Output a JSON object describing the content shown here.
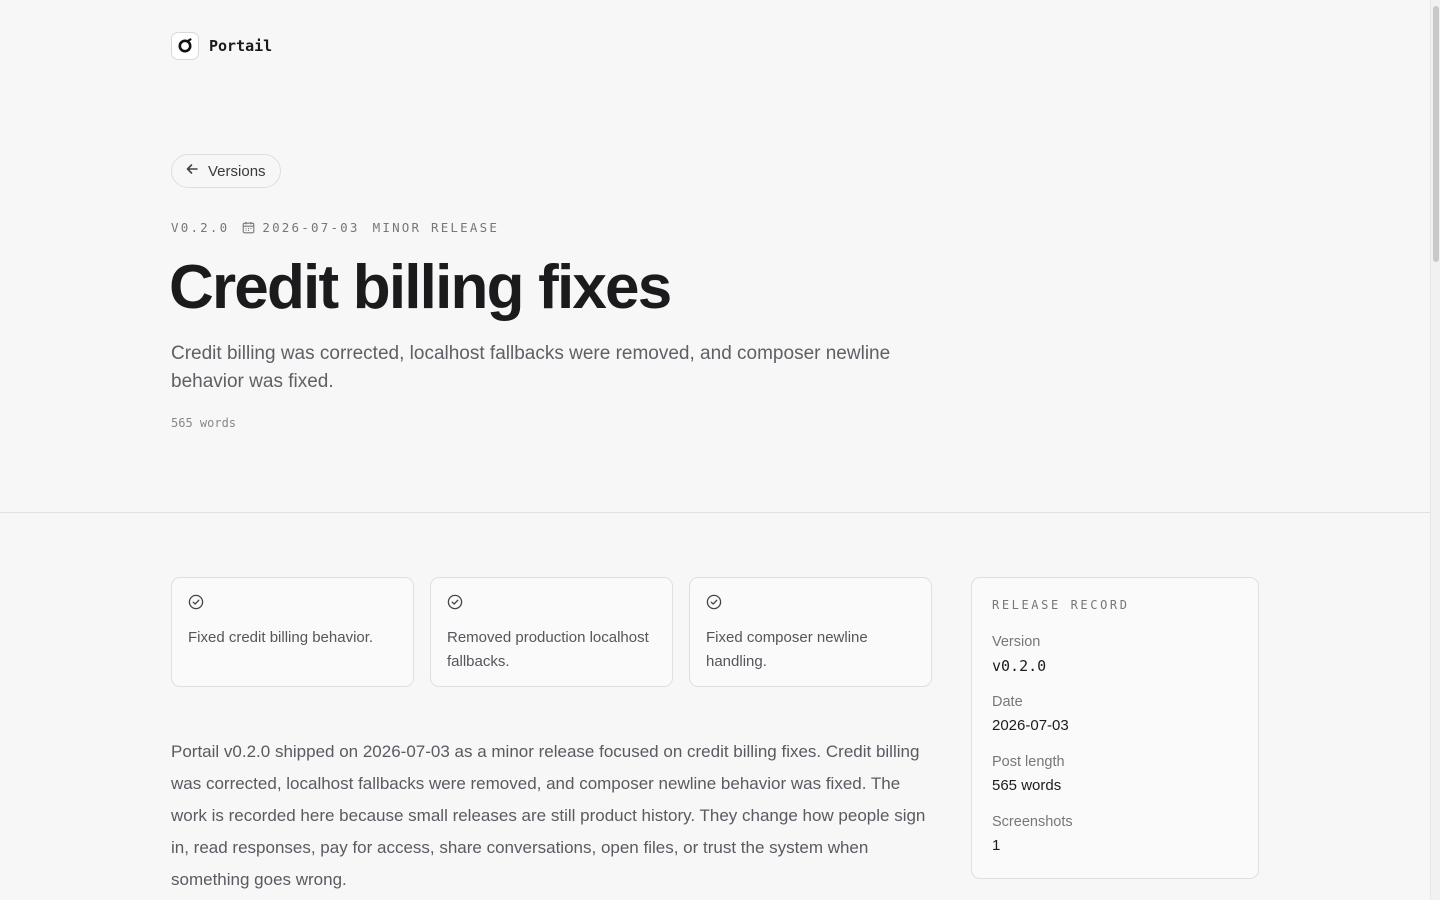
{
  "brand": {
    "name": "Portail"
  },
  "nav": {
    "back_label": "Versions"
  },
  "release": {
    "version": "V0.2.0",
    "date": "2026-07-03",
    "type": "MINOR RELEASE",
    "title": "Credit billing fixes",
    "summary": "Credit billing was corrected, localhost fallbacks were removed, and composer newline behavior was fixed.",
    "word_count": "565 words"
  },
  "highlights": [
    {
      "text": "Fixed credit billing behavior."
    },
    {
      "text": "Removed production localhost fallbacks."
    },
    {
      "text": "Fixed composer newline handling."
    }
  ],
  "body": "Portail v0.2.0 shipped on 2026-07-03 as a minor release focused on credit billing fixes. Credit billing was corrected, localhost fallbacks were removed, and composer newline behavior was fixed. The work is recorded here because small releases are still product history. They change how people sign in, read responses, pay for access, share conversations, open files, or trust the system when something goes wrong.",
  "record": {
    "heading": "RELEASE RECORD",
    "rows": [
      {
        "label": "Version",
        "value": "v0.2.0"
      },
      {
        "label": "Date",
        "value": "2026-07-03"
      },
      {
        "label": "Post length",
        "value": "565 words"
      },
      {
        "label": "Screenshots",
        "value": "1"
      }
    ]
  },
  "icons": {
    "logo": "portail-logo-icon",
    "back": "arrow-left-icon",
    "calendar": "calendar-icon",
    "check": "check-circle-icon"
  }
}
